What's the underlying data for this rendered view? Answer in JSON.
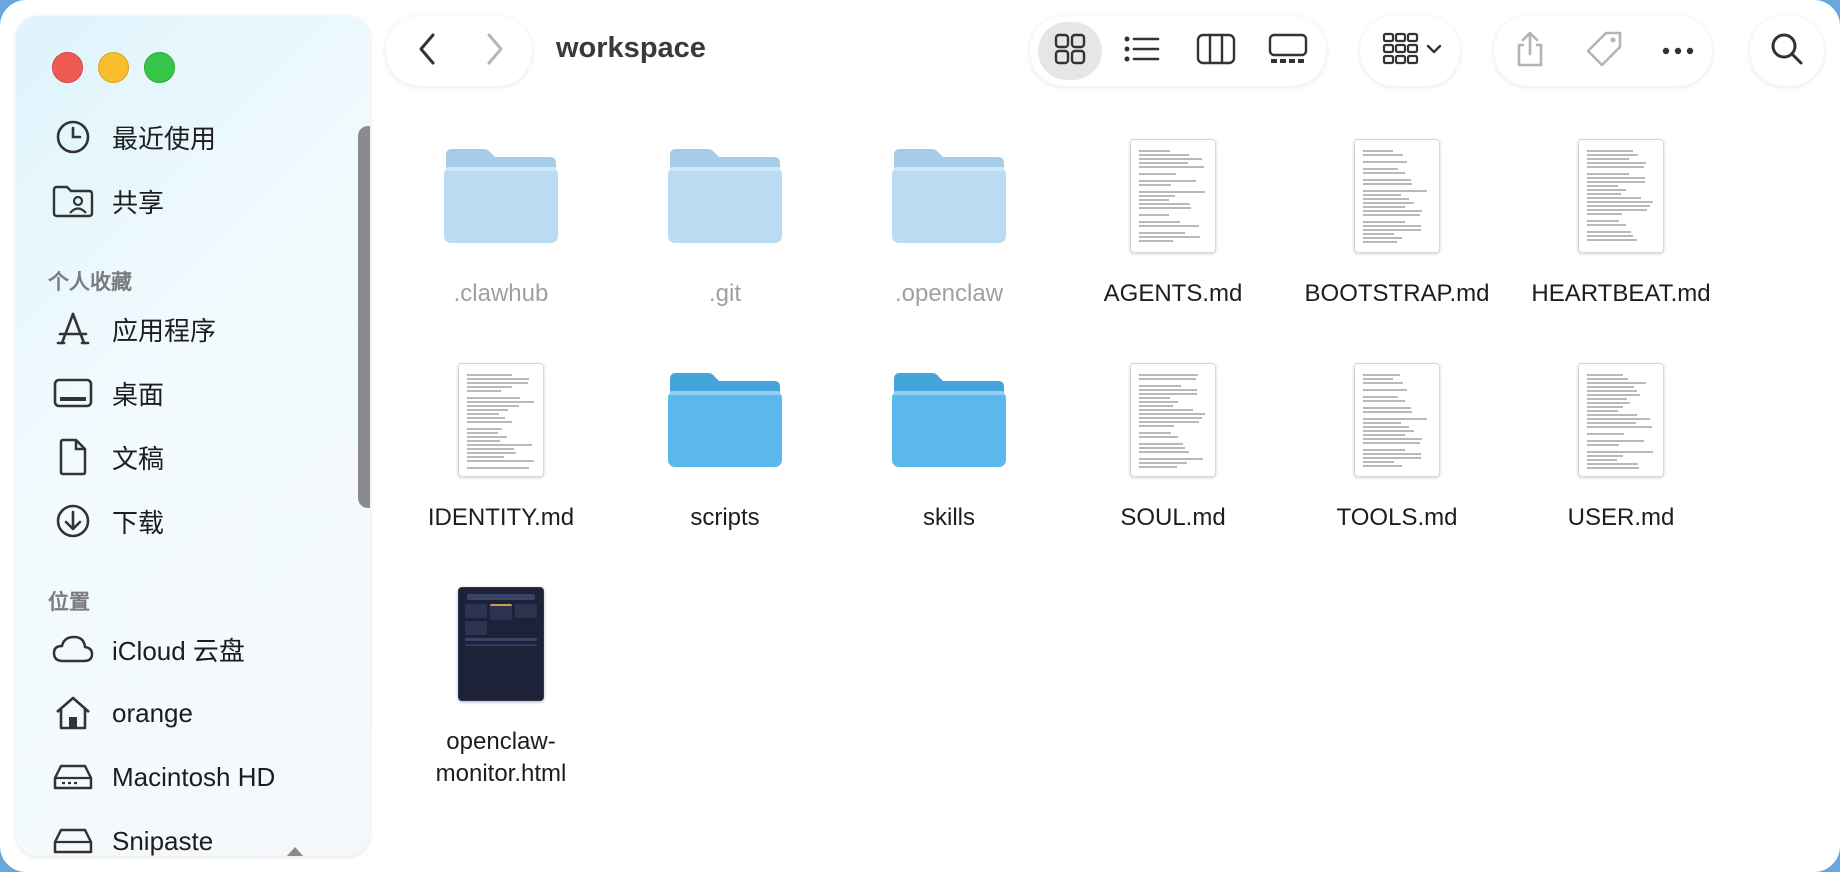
{
  "window": {
    "title": "workspace"
  },
  "sidebar": {
    "favorites_header": "个人收藏",
    "locations_header": "位置",
    "top_items": [
      {
        "label": "最近使用",
        "icon": "clock-icon"
      },
      {
        "label": "共享",
        "icon": "shared-folder-icon"
      }
    ],
    "favorites": [
      {
        "label": "应用程序",
        "icon": "applications-icon"
      },
      {
        "label": "桌面",
        "icon": "desktop-icon"
      },
      {
        "label": "文稿",
        "icon": "document-icon"
      },
      {
        "label": "下载",
        "icon": "download-icon"
      }
    ],
    "locations": [
      {
        "label": "iCloud 云盘",
        "icon": "cloud-icon"
      },
      {
        "label": "orange",
        "icon": "home-icon"
      },
      {
        "label": "Macintosh HD",
        "icon": "disk-icon"
      },
      {
        "label": "Snipaste",
        "icon": "external-disk-icon"
      }
    ]
  },
  "toolbar": {
    "back_icon": "chevron-left-icon",
    "forward_icon": "chevron-right-icon",
    "view_modes": [
      "icon-view",
      "list-view",
      "column-view",
      "gallery-view"
    ],
    "active_view": "icon-view",
    "group_icon": "group-by-icon",
    "actions": [
      "share-icon",
      "tag-icon",
      "more-icon"
    ],
    "search_icon": "search-icon"
  },
  "files": [
    {
      "name": ".clawhub",
      "kind": "folder",
      "hidden": true
    },
    {
      "name": ".git",
      "kind": "folder",
      "hidden": true
    },
    {
      "name": ".openclaw",
      "kind": "folder",
      "hidden": true
    },
    {
      "name": "AGENTS.md",
      "kind": "doc",
      "hidden": false
    },
    {
      "name": "BOOTSTRAP.md",
      "kind": "doc",
      "hidden": false
    },
    {
      "name": "HEARTBEAT.md",
      "kind": "doc",
      "hidden": false
    },
    {
      "name": "IDENTITY.md",
      "kind": "doc",
      "hidden": false
    },
    {
      "name": "scripts",
      "kind": "folder",
      "hidden": false
    },
    {
      "name": "skills",
      "kind": "folder",
      "hidden": false
    },
    {
      "name": "SOUL.md",
      "kind": "doc",
      "hidden": false
    },
    {
      "name": "TOOLS.md",
      "kind": "doc",
      "hidden": false
    },
    {
      "name": "USER.md",
      "kind": "doc",
      "hidden": false
    },
    {
      "name": "openclaw-monitor.html",
      "display": "openclaw-\nmonitor.html",
      "kind": "html",
      "hidden": false
    }
  ],
  "colors": {
    "folder_hidden": "#b9dcf2",
    "folder_visible": "#5bb8ea",
    "accent": "#0a84ff"
  }
}
